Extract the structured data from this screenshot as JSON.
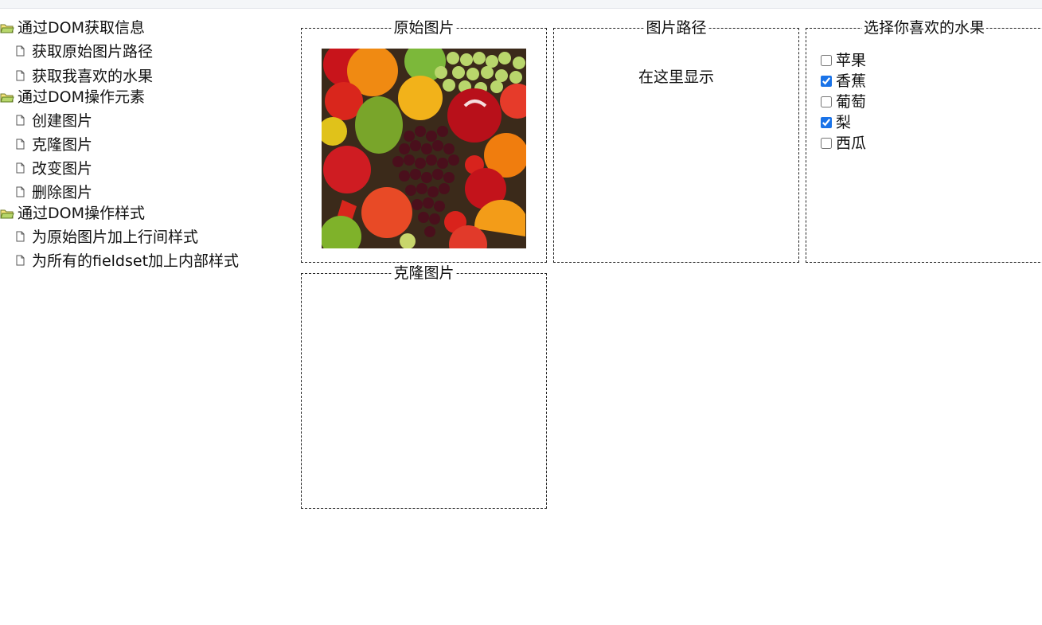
{
  "tree": {
    "groups": [
      {
        "label": "通过DOM获取信息",
        "items": [
          "获取原始图片路径",
          "获取我喜欢的水果"
        ]
      },
      {
        "label": "通过DOM操作元素",
        "items": [
          "创建图片",
          "克隆图片",
          "改变图片",
          "删除图片"
        ]
      },
      {
        "label": "通过DOM操作样式",
        "items": [
          "为原始图片加上行间样式",
          "为所有的fieldset加上内部样式"
        ]
      }
    ]
  },
  "panels": {
    "original": {
      "legend": "原始图片"
    },
    "path": {
      "legend": "图片路径",
      "text": "在这里显示"
    },
    "fruits": {
      "legend": "选择你喜欢的水果",
      "options": [
        {
          "label": "苹果",
          "checked": false
        },
        {
          "label": "香蕉",
          "checked": true
        },
        {
          "label": "葡萄",
          "checked": false
        },
        {
          "label": "梨",
          "checked": true
        },
        {
          "label": "西瓜",
          "checked": false
        }
      ]
    },
    "clone": {
      "legend": "克隆图片"
    }
  }
}
